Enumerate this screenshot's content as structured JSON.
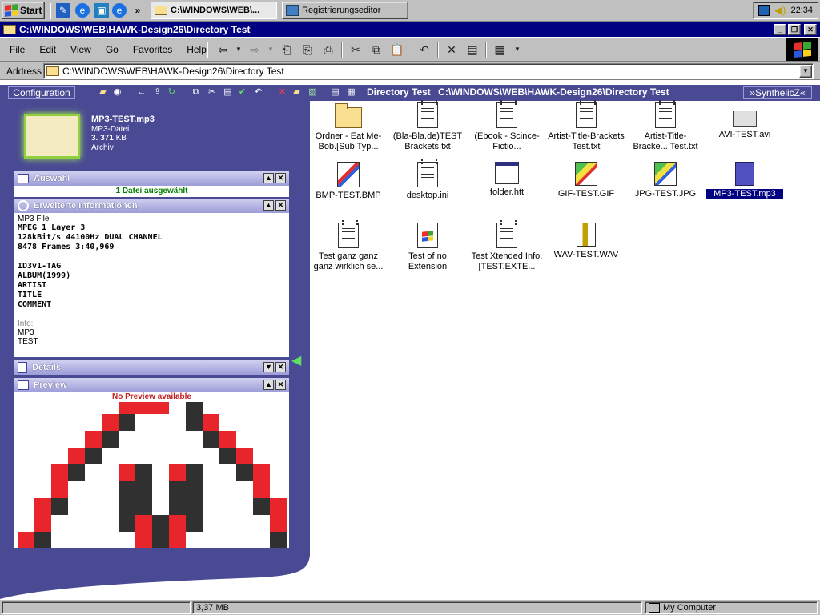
{
  "taskbar": {
    "start_label": "Start",
    "tasks": [
      {
        "label": "C:\\WINDOWS\\WEB\\...",
        "icon": "folder-icon"
      },
      {
        "label": "Registrierungseditor",
        "icon": "regedit-icon"
      }
    ],
    "clock": "22:34"
  },
  "window": {
    "title": "C:\\WINDOWS\\WEB\\HAWK-Design26\\Directory Test"
  },
  "menu": {
    "items": [
      "File",
      "Edit",
      "View",
      "Go",
      "Favorites",
      "Help"
    ]
  },
  "address": {
    "label": "Address",
    "value": "C:\\WINDOWS\\WEB\\HAWK-Design26\\Directory Test"
  },
  "content_toolbar": {
    "config_label": "Configuration",
    "folder_name": "Directory Test",
    "folder_path": "C:\\WINDOWS\\WEB\\HAWK-Design26\\Directory Test",
    "brand_label": "»SynthelicZ«"
  },
  "file_info": {
    "name": "MP3-TEST.mp3",
    "type": "MP3-Datei",
    "size": "3. 371",
    "size_unit": "KB",
    "attr": "Archiv"
  },
  "sections": {
    "selection": {
      "title": "Auswahl",
      "text": "1 Datei ausgewählt"
    },
    "extended": {
      "title": "Erweiterte Informationen",
      "file_type": "MP3 File",
      "lines": [
        "MPEG 1 Layer 3",
        "128kBit/s 44100Hz DUAL CHANNEL",
        "8478 Frames 3:40,969"
      ],
      "tag_lines": [
        "ID3v1-TAG",
        "ALBUM(1999)",
        "ARTIST",
        "TITLE",
        "COMMENT"
      ],
      "info_label": "Info:",
      "info_lines": [
        "MP3",
        "TEST"
      ]
    },
    "details": {
      "title": "Details"
    },
    "preview": {
      "title": "Preview",
      "no_preview": "No Preview available"
    }
  },
  "files": [
    {
      "label": "Ordner - Eat Me-Bob.[Sub Typ...",
      "icon": "folder-icon"
    },
    {
      "label": "(Bla-Bla.de)TEST Brackets.txt",
      "icon": "text-file-icon"
    },
    {
      "label": "(Ebook - Scince-Fictio...",
      "icon": "text-file-icon"
    },
    {
      "label": "Artist-Title-Brackets Test.txt",
      "icon": "text-file-icon"
    },
    {
      "label": "Artist-Title-Bracke... Test.txt",
      "icon": "text-file-icon"
    },
    {
      "label": "AVI-TEST.avi",
      "icon": "video-file-icon"
    },
    {
      "label": "BMP-TEST.BMP",
      "icon": "paint-file-icon"
    },
    {
      "label": "desktop.ini",
      "icon": "settings-file-icon"
    },
    {
      "label": "folder.htt",
      "icon": "htt-file-icon"
    },
    {
      "label": "GIF-TEST.GIF",
      "icon": "image-file-icon"
    },
    {
      "label": "JPG-TEST.JPG",
      "icon": "image-file-icon"
    },
    {
      "label": "MP3-TEST.mp3",
      "icon": "audio-file-icon"
    },
    {
      "label": "Test ganz ganz ganz wirklich se...",
      "icon": "text-file-icon"
    },
    {
      "label": "Test of no Extension",
      "icon": "windows-file-icon"
    },
    {
      "label": "Test Xtended Info.[TEST.EXTE...",
      "icon": "text-file-icon"
    },
    {
      "label": "WAV-TEST.WAV",
      "icon": "audio-file-icon"
    }
  ],
  "status": {
    "size": "3,37 MB",
    "zone": "My Computer"
  },
  "colors": {
    "panel": "#4a4a94",
    "title": "#000080",
    "preview_red": "#e8252a",
    "preview_dark": "#303030"
  }
}
